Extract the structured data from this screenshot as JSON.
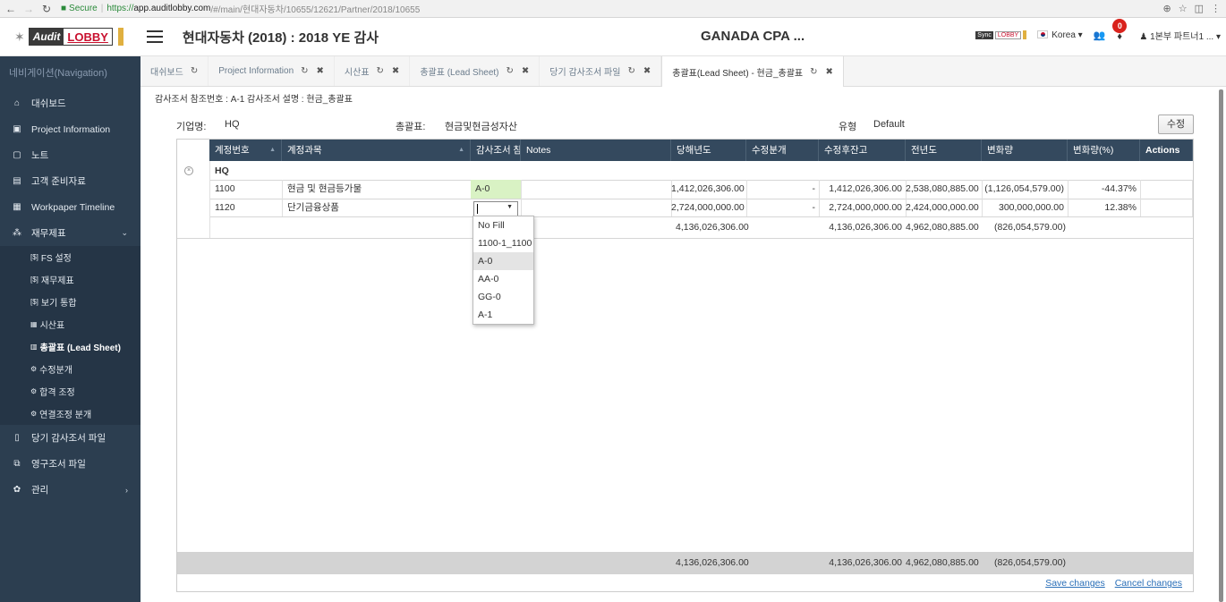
{
  "browser": {
    "secure_label": "Secure",
    "url_scheme": "https://",
    "url_host": "app.auditlobby.com",
    "url_path": "/#/main/현대자동차/10655/12621/Partner/2018/10655"
  },
  "header": {
    "logo_audit": "Audit",
    "logo_lobby": "LOBBY",
    "project_title": "현대자동차 (2018) : 2018 YE 감사",
    "firm_name": "GANADA CPA ...",
    "sync_label_1": "Sync",
    "sync_label_2": "LOBBY",
    "country": "Korea",
    "notification_count": "0",
    "user": "1본부 파트너1 ..."
  },
  "sidebar": {
    "title": "네비게이션(Navigation)",
    "items": [
      {
        "label": "대쉬보드",
        "icon": "home-icon"
      },
      {
        "label": "Project Information",
        "icon": "info-icon"
      },
      {
        "label": "노트",
        "icon": "note-icon"
      },
      {
        "label": "고객 준비자료",
        "icon": "folder-icon"
      },
      {
        "label": "Workpaper Timeline",
        "icon": "calendar-icon"
      },
      {
        "label": "재무제표",
        "icon": "share-icon"
      }
    ],
    "subitems": [
      {
        "label": "FS 설정",
        "icon": "fs-icon"
      },
      {
        "label": "재무제표",
        "icon": "fs-icon"
      },
      {
        "label": "보기 통합",
        "icon": "fs-icon"
      },
      {
        "label": "시산표",
        "icon": "table-icon"
      },
      {
        "label": "총괄표 (Lead Sheet)",
        "icon": "table-icon"
      },
      {
        "label": "수정분개",
        "icon": "gears-icon"
      },
      {
        "label": "합격 조정",
        "icon": "gears-icon"
      },
      {
        "label": "연결조정 분개",
        "icon": "gears-icon"
      }
    ],
    "bottom_items": [
      {
        "label": "당기 감사조서 파일",
        "icon": "file-icon"
      },
      {
        "label": "영구조서 파일",
        "icon": "files-icon"
      },
      {
        "label": "관리",
        "icon": "settings-icon"
      }
    ]
  },
  "tabs": [
    {
      "label": "대쉬보드"
    },
    {
      "label": "Project Information"
    },
    {
      "label": "시산표"
    },
    {
      "label": "총괄표 (Lead Sheet)"
    },
    {
      "label": "당기 감사조서 파일"
    },
    {
      "label": "총괄표(Lead Sheet) - 현금_총괄표"
    }
  ],
  "content": {
    "ref_line": "감사조서 참조번호 : A-1   감사조서 설명 : 현금_총괄표",
    "company_label": "기업명:",
    "company_value": "HQ",
    "lead_label": "총괄표:",
    "lead_value": "현금및현금성자산",
    "type_label": "유형",
    "type_value": "Default",
    "edit_button": "수정"
  },
  "grid": {
    "headers": [
      "계정번호",
      "계정과목",
      "감사조서 참",
      "Notes",
      "당해년도",
      "수정분개",
      "수정후잔고",
      "전년도",
      "변화량",
      "변화량(%)",
      "Actions"
    ],
    "group_label": "HQ",
    "rows": [
      {
        "account_no": "1100",
        "account_name": "현금 및 현금등가물",
        "workpaper": "A-0",
        "notes": "",
        "current": "1,412,026,306.00",
        "adjustment": "-",
        "adjusted": "1,412,026,306.00",
        "prior": "2,538,080,885.00",
        "change": "(1,126,054,579.00)",
        "change_pct": "-44.37%"
      },
      {
        "account_no": "1120",
        "account_name": "단기금융상품",
        "workpaper": "",
        "notes": "",
        "current": "2,724,000,000.00",
        "adjustment": "-",
        "adjusted": "2,724,000,000.00",
        "prior": "2,424,000,000.00",
        "change": "300,000,000.00",
        "change_pct": "12.38%"
      }
    ],
    "subtotal": {
      "current": "4,136,026,306.00",
      "adjusted": "4,136,026,306.00",
      "prior": "4,962,080,885.00",
      "change": "(826,054,579.00)"
    },
    "total": {
      "current": "4,136,026,306.00",
      "adjusted": "4,136,026,306.00",
      "prior": "4,962,080,885.00",
      "change": "(826,054,579.00)"
    },
    "dropdown_options": [
      "No Fill",
      "1100-1_1100",
      "A-0",
      "AA-0",
      "GG-0",
      "A-1"
    ],
    "dropdown_highlighted": "A-0"
  },
  "footer": {
    "save_label": "Save changes",
    "cancel_label": "Cancel changes"
  }
}
